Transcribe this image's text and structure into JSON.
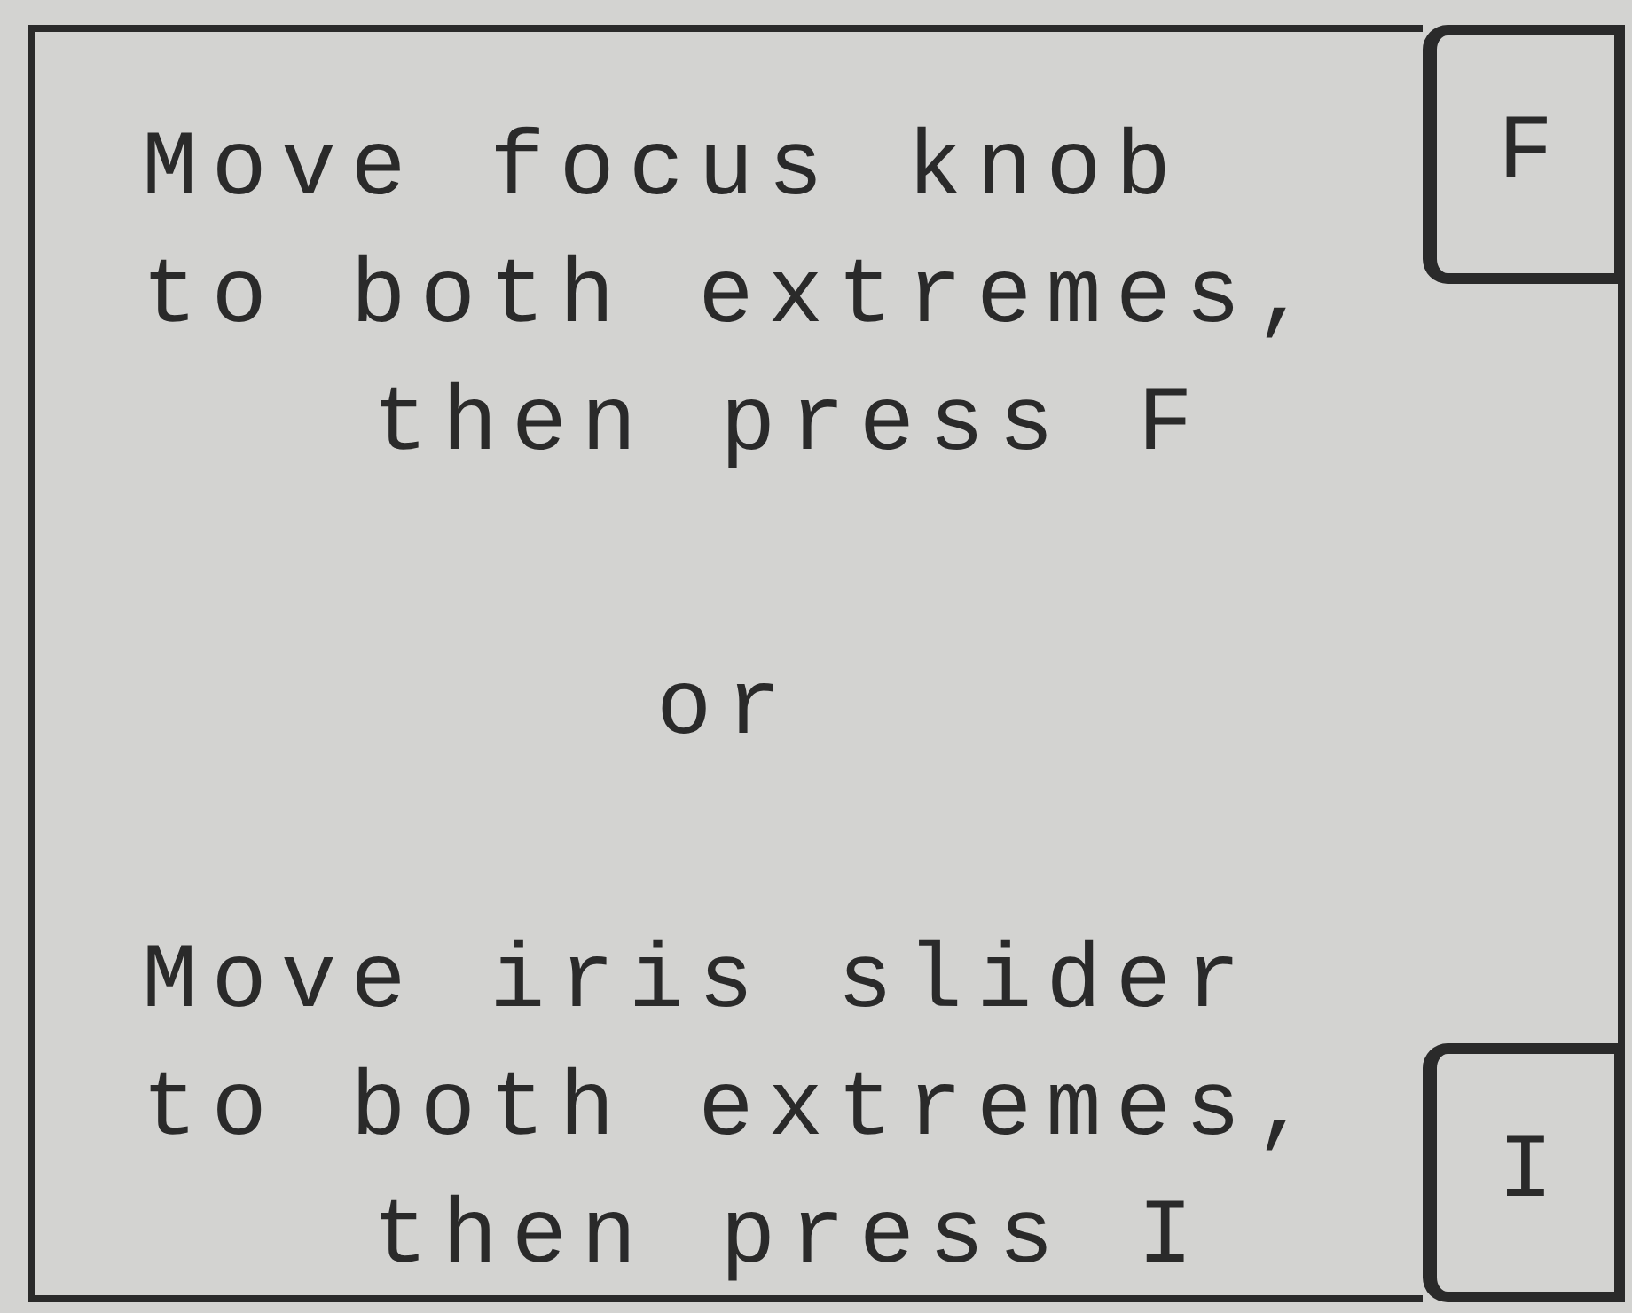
{
  "messages": [
    {
      "lines": [
        "Move focus knob",
        "to both extremes,",
        "then press F"
      ]
    },
    {
      "lines": [
        "Move iris slider",
        "to both extremes,",
        "then press I"
      ]
    }
  ],
  "separator": "or",
  "keys": [
    {
      "label": "F"
    },
    {
      "label": "I"
    }
  ]
}
